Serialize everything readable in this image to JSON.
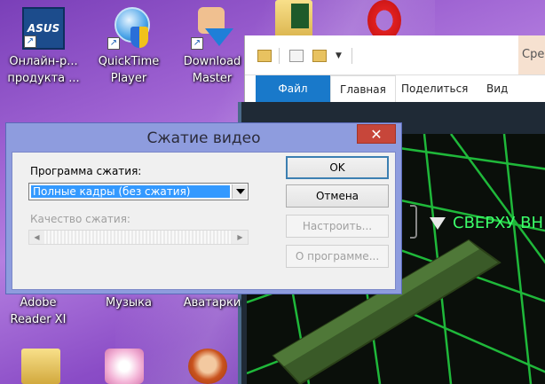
{
  "desktop": {
    "icons": [
      {
        "label_line1": "Онлайн-р...",
        "label_line2": "продукта ...",
        "icon": "asus-icon",
        "badge_text": "ASUS"
      },
      {
        "label_line1": "QuickTime",
        "label_line2": "Player",
        "icon": "quicktime-icon"
      },
      {
        "label_line1": "Download",
        "label_line2": "Master",
        "icon": "download-master-icon"
      }
    ],
    "lower_labels": [
      {
        "line1": "Adobe",
        "line2": "Reader XI"
      },
      {
        "line1": "Музыка",
        "line2": ""
      },
      {
        "line1": "Аватарки",
        "line2": ""
      }
    ]
  },
  "explorer": {
    "title_fragment": "Сре",
    "tabs": [
      "Файл",
      "Главная",
      "Поделиться",
      "Вид"
    ]
  },
  "game": {
    "label": "СВЕРХУ ВН",
    "text_color": "#3cff6a"
  },
  "dialog": {
    "title": "Сжатие видео",
    "close_label": "✕",
    "compressor_label": "Программа сжатия:",
    "compressor_value": "Полные кадры (без сжатия)",
    "quality_label": "Качество сжатия:",
    "buttons": {
      "ok": "OK",
      "cancel": "Отмена",
      "configure": "Настроить...",
      "about": "О программе..."
    }
  },
  "colors": {
    "dialog_frame": "#8e9cde",
    "selection": "#3399ff",
    "close": "#c7463a",
    "file_tab": "#1979ca"
  }
}
